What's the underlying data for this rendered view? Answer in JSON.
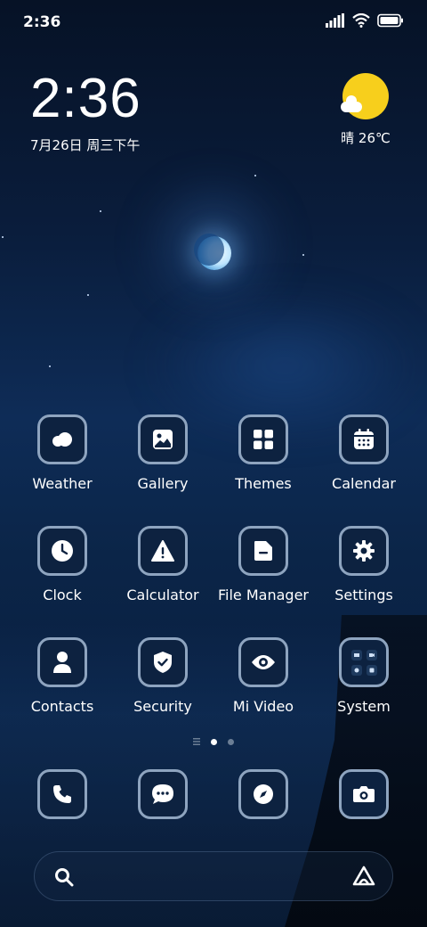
{
  "status_bar": {
    "time": "2:36"
  },
  "clock_widget": {
    "time": "2:36",
    "date": "7月26日 周三下午"
  },
  "weather_widget": {
    "text": "晴 26℃",
    "icon": "sunny-cloud-icon"
  },
  "apps": [
    {
      "label": "Weather",
      "icon": "weather-icon"
    },
    {
      "label": "Gallery",
      "icon": "gallery-icon"
    },
    {
      "label": "Themes",
      "icon": "themes-icon"
    },
    {
      "label": "Calendar",
      "icon": "calendar-icon"
    },
    {
      "label": "Clock",
      "icon": "clock-icon"
    },
    {
      "label": "Calculator",
      "icon": "calculator-icon"
    },
    {
      "label": "File Manager",
      "icon": "file-manager-icon"
    },
    {
      "label": "Settings",
      "icon": "gear-icon"
    },
    {
      "label": "Contacts",
      "icon": "contacts-icon"
    },
    {
      "label": "Security",
      "icon": "shield-icon"
    },
    {
      "label": "Mi Video",
      "icon": "eye-icon"
    },
    {
      "label": "System",
      "icon": "folder-icon"
    }
  ],
  "page_indicator": {
    "pages": 2,
    "current": 1
  },
  "dock": [
    {
      "icon": "phone-icon"
    },
    {
      "icon": "messages-icon"
    },
    {
      "icon": "browser-icon"
    },
    {
      "icon": "camera-icon"
    }
  ],
  "search_bar": {
    "left_icon": "search-icon",
    "right_icon": "app-vault-icon"
  },
  "colors": {
    "icon_border": "#8ea4bf",
    "icon_fill": "#0d2240",
    "sun": "#f7cf1c"
  }
}
